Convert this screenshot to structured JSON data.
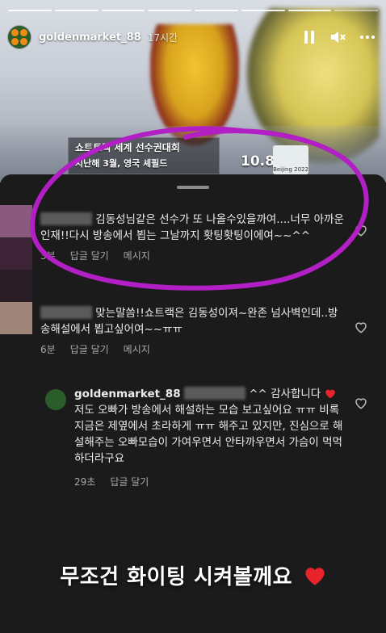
{
  "story": {
    "username": "goldenmarket_88",
    "time": "17시간",
    "progress_segments": 8,
    "progress_active": 7
  },
  "video": {
    "caption_line1": "쇼트트랙 세계 선수권대회",
    "caption_line2": "지난해 3월, 영국 셰필드",
    "score": "10.8",
    "logo_text": "Beijing 2022"
  },
  "comments": [
    {
      "text": "김동성님같은 선수가 또 나올수있을까여....너무 아까운 인재!!다시 방송에서 뵙는 그날까지 홧팅홧팅이에여~~^^",
      "time": "3분",
      "reply": "답글 달기",
      "message": "메시지"
    },
    {
      "text": "맞는말씀!!쇼트랙은 김동성이져~완존 넘사벽인데..방송해설에서 뵙고싶어여~~ㅠㅠ",
      "time": "6분",
      "reply": "답글 달기",
      "message": "메시지"
    },
    {
      "name": "goldenmarket_88",
      "text_head": "^^ 감사합니다",
      "text": "저도 오빠가 방송에서 해설하는 모습 보고싶어요 ㅠㅠ 비록 지금은 제옆에서 초라하게 ㅠㅠ 해주고 있지만, 진심으로 해설해주는 오빠모습이 가여우면서 안타까우면서 가슴이 먹먹하더라구요",
      "time": "29초",
      "reply": "답글 달기"
    }
  ],
  "overlay_text": "무조건 화이팅 시켜볼께요",
  "colors": {
    "annotation": "#b21fc4",
    "heart": "#e8232c",
    "sheet": "#1b1b1b"
  },
  "icons": [
    "pause-icon",
    "mute-icon",
    "more-icon",
    "heart-icon",
    "heart-emoji-icon"
  ]
}
